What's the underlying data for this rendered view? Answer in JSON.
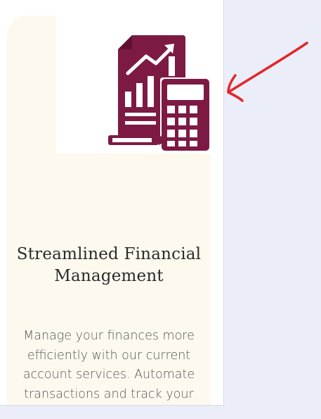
{
  "feature": {
    "title": "Streamlined Financial Management",
    "description": "Manage your finances more efficiently with our current account services. Automate transactions and track your"
  },
  "icon": {
    "name": "financial-report-calculator-icon",
    "color": "#7d1a44"
  },
  "annotation": {
    "name": "red-arrow-annotation",
    "color": "#e3262b"
  },
  "colors": {
    "card_background": "#fdf9ef",
    "page_background": "#ebeef8"
  }
}
